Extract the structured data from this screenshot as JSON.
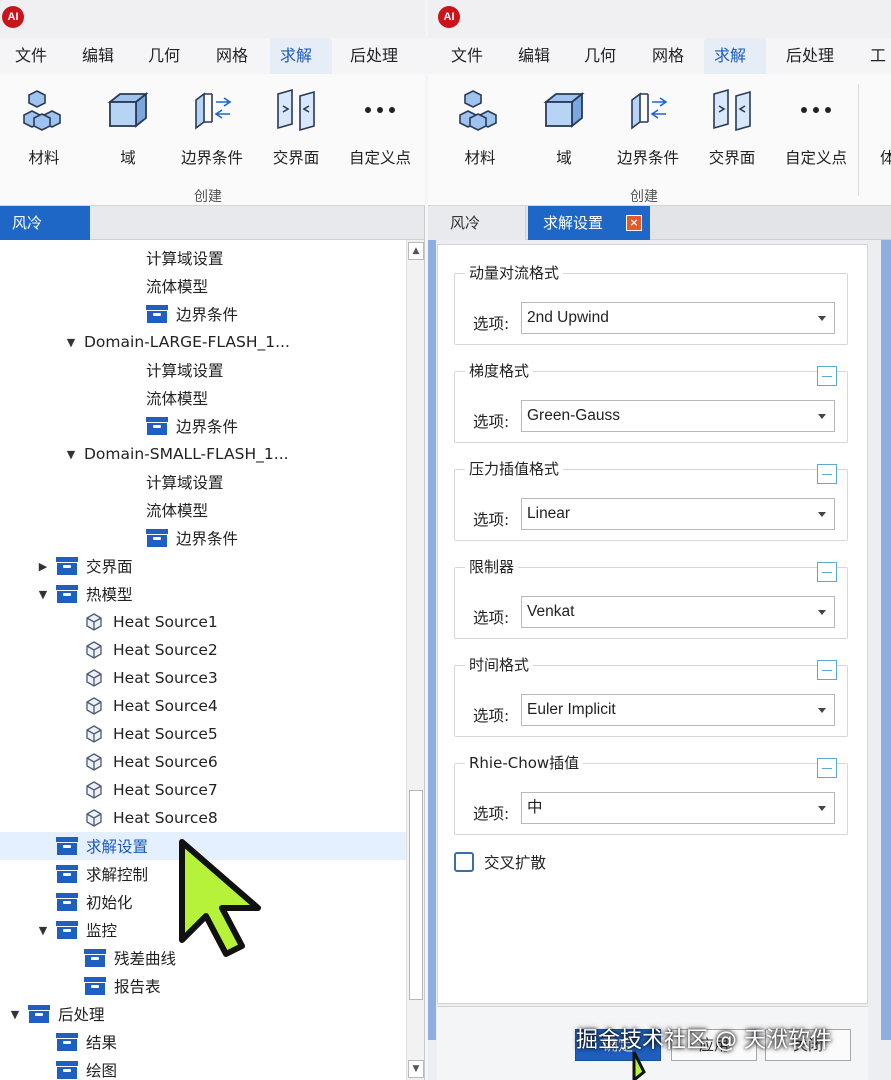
{
  "app": {
    "logo_text": "AI"
  },
  "menu_tabs": [
    "文件",
    "编辑",
    "几何",
    "网格",
    "求解",
    "后处理",
    "工具"
  ],
  "active_menu": "求解",
  "ribbon": {
    "buttons": [
      {
        "label": "材料",
        "icon": "material-cubes-icon"
      },
      {
        "label": "域",
        "icon": "domain-box-icon"
      },
      {
        "label": "边界条件",
        "icon": "boundary-condition-icon"
      },
      {
        "label": "交界面",
        "icon": "interface-icon"
      },
      {
        "label": "自定义点",
        "icon": "more-dots-icon"
      }
    ],
    "group_label": "创建",
    "partial_right": "体"
  },
  "left_panel": {
    "tab_label": "风冷",
    "tree": [
      {
        "label": "计算域设置",
        "level": 3,
        "icon": "none"
      },
      {
        "label": "流体模型",
        "level": 3,
        "icon": "none"
      },
      {
        "label": "边界条件",
        "level": 3,
        "icon": "folder"
      },
      {
        "label": "Domain-LARGE-FLASH_1...",
        "level": 2,
        "icon": "none",
        "caret": "down"
      },
      {
        "label": "计算域设置",
        "level": 3,
        "icon": "none"
      },
      {
        "label": "流体模型",
        "level": 3,
        "icon": "none"
      },
      {
        "label": "边界条件",
        "level": 3,
        "icon": "folder"
      },
      {
        "label": "Domain-SMALL-FLASH_1...",
        "level": 2,
        "icon": "none",
        "caret": "down"
      },
      {
        "label": "计算域设置",
        "level": 3,
        "icon": "none"
      },
      {
        "label": "流体模型",
        "level": 3,
        "icon": "none"
      },
      {
        "label": "边界条件",
        "level": 3,
        "icon": "folder"
      },
      {
        "label": "交界面",
        "level": 1,
        "icon": "folder",
        "caret": "right"
      },
      {
        "label": "热模型",
        "level": 1,
        "icon": "folder",
        "caret": "down"
      },
      {
        "label": "Heat Source1",
        "level": 2,
        "icon": "cube"
      },
      {
        "label": "Heat Source2",
        "level": 2,
        "icon": "cube"
      },
      {
        "label": "Heat Source3",
        "level": 2,
        "icon": "cube"
      },
      {
        "label": "Heat Source4",
        "level": 2,
        "icon": "cube"
      },
      {
        "label": "Heat Source5",
        "level": 2,
        "icon": "cube"
      },
      {
        "label": "Heat Source6",
        "level": 2,
        "icon": "cube"
      },
      {
        "label": "Heat Source7",
        "level": 2,
        "icon": "cube"
      },
      {
        "label": "Heat Source8",
        "level": 2,
        "icon": "cube"
      },
      {
        "label": "求解设置",
        "level": 1,
        "icon": "folder",
        "selected": true
      },
      {
        "label": "求解控制",
        "level": 1,
        "icon": "folder"
      },
      {
        "label": "初始化",
        "level": 1,
        "icon": "folder"
      },
      {
        "label": "监控",
        "level": 1,
        "icon": "folder",
        "caret": "down"
      },
      {
        "label": "残差曲线",
        "level": 2,
        "icon": "folder"
      },
      {
        "label": "报告表",
        "level": 2,
        "icon": "folder"
      },
      {
        "label": "后处理",
        "level": 0,
        "icon": "folder",
        "caret": "down"
      },
      {
        "label": "结果",
        "level": 1,
        "icon": "folder"
      },
      {
        "label": "绘图",
        "level": 1,
        "icon": "folder"
      }
    ]
  },
  "right_panel": {
    "tabs": {
      "inactive": "风冷",
      "active": "求解设置"
    },
    "option_label": "选项:",
    "groups": [
      {
        "title": "动量对流格式",
        "value": "2nd Upwind",
        "collapsible": false
      },
      {
        "title": "梯度格式",
        "value": "Green-Gauss",
        "collapsible": true
      },
      {
        "title": "压力插值格式",
        "value": "Linear",
        "collapsible": true
      },
      {
        "title": "限制器",
        "value": "Venkat",
        "collapsible": true
      },
      {
        "title": "时间格式",
        "value": "Euler Implicit",
        "collapsible": true
      },
      {
        "title": "Rhie-Chow插值",
        "value": "中",
        "collapsible": true
      }
    ],
    "checkbox_label": "交叉扩散",
    "buttons": {
      "ok": "确定",
      "apply": "应用",
      "cancel": "关闭"
    }
  },
  "watermark": "掘金技术社区 @ 天洑软件"
}
